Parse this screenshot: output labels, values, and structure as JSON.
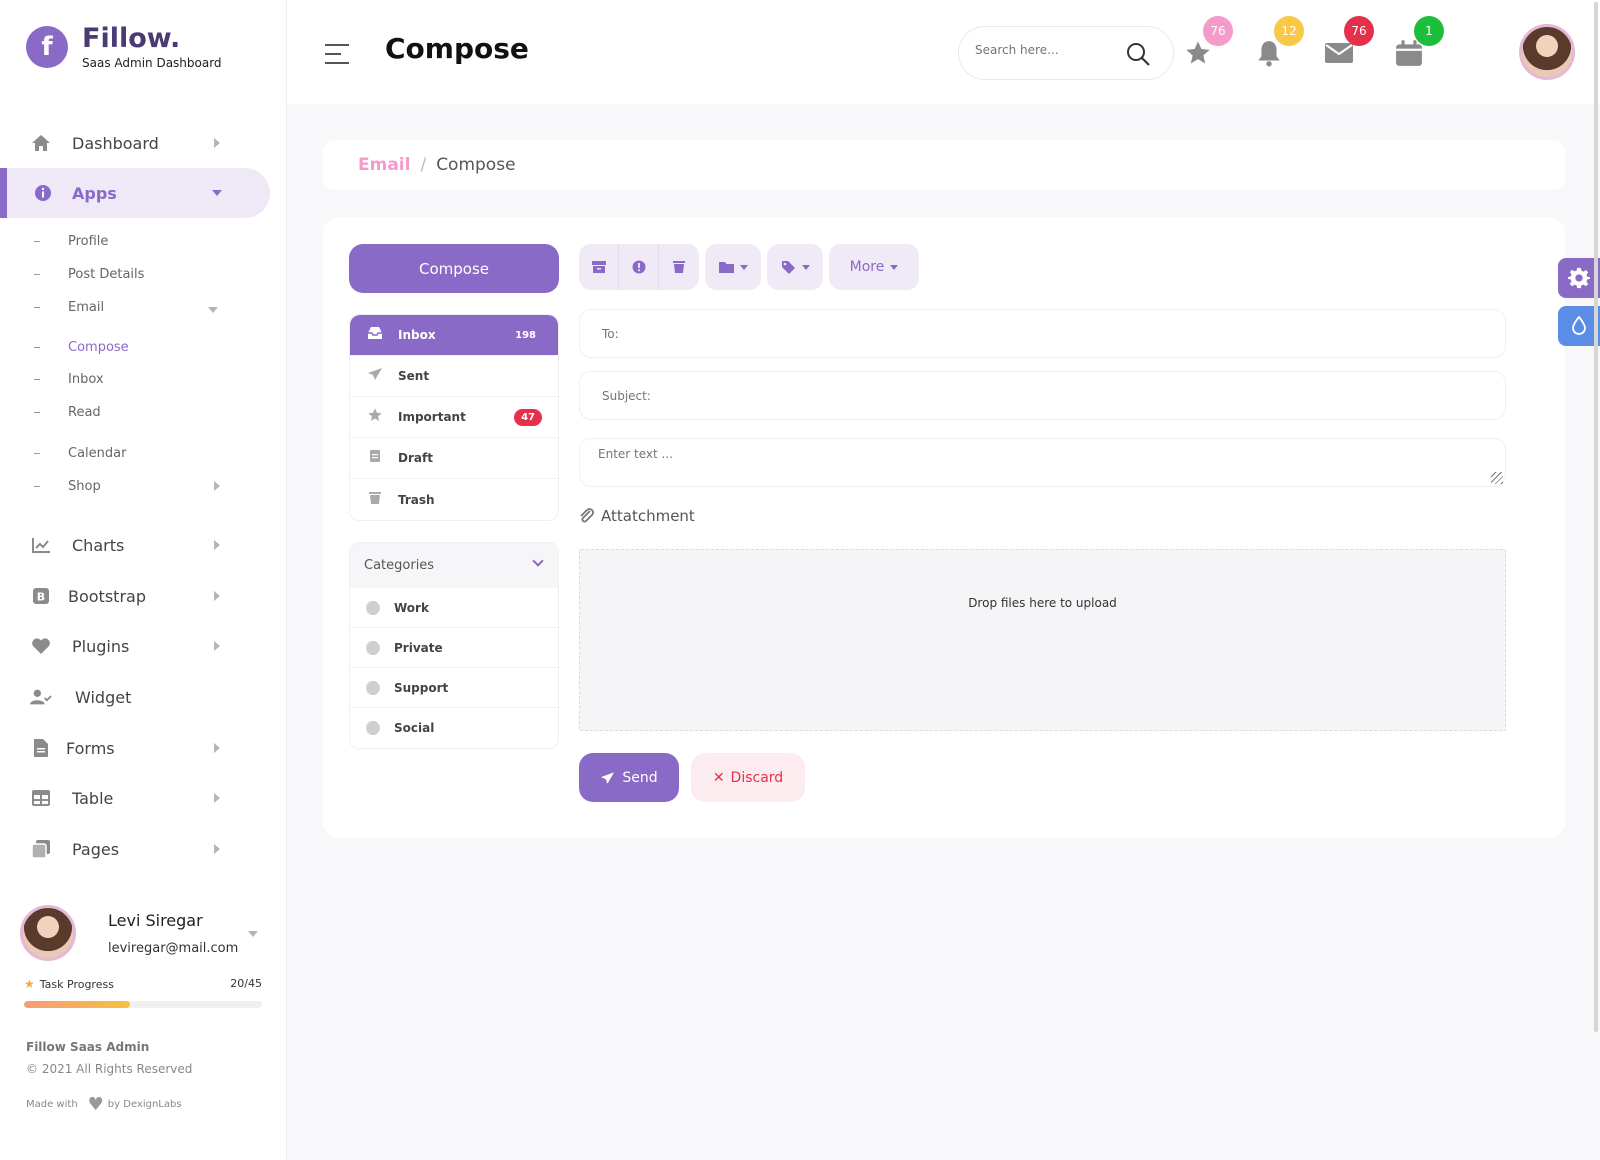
{
  "brand": {
    "logo_letter": "f",
    "name": "Fillow.",
    "subtitle": "Saas Admin Dashboard"
  },
  "sidebar": {
    "items": [
      {
        "label": "Dashboard",
        "icon": "home-icon"
      },
      {
        "label": "Apps",
        "icon": "info-icon",
        "active": true
      },
      {
        "label": "Charts",
        "icon": "chart-line-icon"
      },
      {
        "label": "Bootstrap",
        "icon": "bootstrap-icon"
      },
      {
        "label": "Plugins",
        "icon": "heart-icon"
      },
      {
        "label": "Widget",
        "icon": "user-check-icon"
      },
      {
        "label": "Forms",
        "icon": "file-icon"
      },
      {
        "label": "Table",
        "icon": "table-icon"
      },
      {
        "label": "Pages",
        "icon": "copy-icon"
      }
    ],
    "apps_sub": {
      "profile": "Profile",
      "post_details": "Post Details",
      "email": "Email",
      "compose": "Compose",
      "inbox": "Inbox",
      "read": "Read",
      "calendar": "Calendar",
      "shop": "Shop"
    }
  },
  "user": {
    "name": "Levi Siregar",
    "email": "leviregar@mail.com",
    "task_label": "Task Progress",
    "task_count": "20/45",
    "progress": 0.444
  },
  "footer": {
    "title": "Fillow Saas Admin",
    "copyright": "© 2021 All Rights Reserved",
    "made_with": "Made with",
    "by": "by DexignLabs"
  },
  "header": {
    "title": "Compose",
    "search_placeholder": "Search here...",
    "badges": {
      "favorites": "76",
      "notifications": "12",
      "messages": "76",
      "calendar": "1"
    }
  },
  "breadcrumb": {
    "parent": "Email",
    "separator": "/",
    "current": "Compose"
  },
  "compose": {
    "compose_label": "Compose",
    "folders": [
      {
        "label": "Inbox",
        "count": "198",
        "icon": "inbox-icon"
      },
      {
        "label": "Sent",
        "icon": "paper-plane-icon"
      },
      {
        "label": "Important",
        "count": "47",
        "icon": "star-icon"
      },
      {
        "label": "Draft",
        "icon": "draft-icon"
      },
      {
        "label": "Trash",
        "icon": "trash-icon"
      }
    ],
    "categories_label": "Categories",
    "categories": [
      "Work",
      "Private",
      "Support",
      "Social"
    ],
    "more_label": "More",
    "to_placeholder": "To:",
    "subject_placeholder": "Subject:",
    "body_placeholder": "Enter text ...",
    "attachment_label": "Attatchment",
    "dropzone_text": "Drop files here to upload",
    "send_label": "Send",
    "discard_label": "Discard"
  },
  "colors": {
    "primary": "#8a6ac7",
    "pink": "#f59bcb",
    "badge_pink": "#f59bcb",
    "badge_yellow": "#f8c846",
    "badge_red": "#e4304b",
    "badge_green": "#1cbf3c",
    "float_blue": "#5b8de6"
  }
}
